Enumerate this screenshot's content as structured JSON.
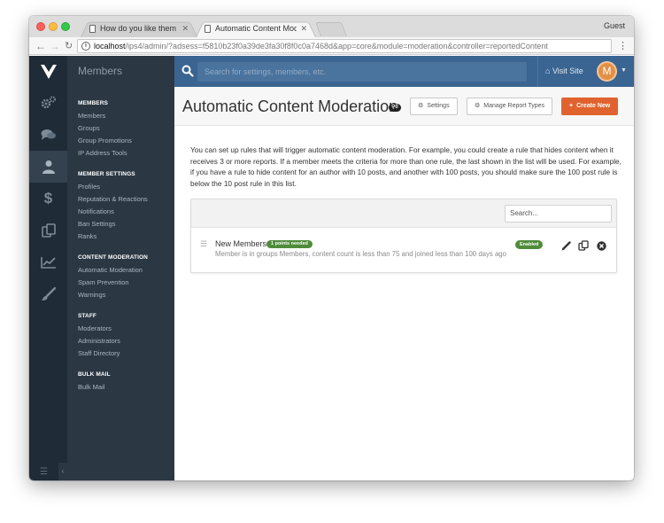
{
  "browser": {
    "tabs": [
      {
        "label": "How do you like them apples?"
      },
      {
        "label": "Automatic Content Moderation"
      }
    ],
    "profile": "Guest",
    "url": {
      "host": "localhost",
      "path": "/ips4/admin/?adsess=f5810b23f0a39de3fa30f8f0c0a7468d&app=core&module=moderation&controller=reportedContent"
    }
  },
  "topbar": {
    "section": "Members",
    "search_placeholder": "Search for settings, members, etc.",
    "visit_site": "Visit Site",
    "avatar_letter": "M"
  },
  "sidebar": {
    "groups": [
      {
        "heading": "MEMBERS",
        "items": [
          "Members",
          "Groups",
          "Group Promotions",
          "IP Address Tools"
        ]
      },
      {
        "heading": "MEMBER SETTINGS",
        "items": [
          "Profiles",
          "Reputation & Reactions",
          "Notifications",
          "Ban Settings",
          "Ranks"
        ]
      },
      {
        "heading": "CONTENT MODERATION",
        "items": [
          "Automatic Moderation",
          "Spam Prevention",
          "Warnings"
        ]
      },
      {
        "heading": "STAFF",
        "items": [
          "Moderators",
          "Administrators",
          "Staff Directory"
        ]
      },
      {
        "heading": "BULK MAIL",
        "items": [
          "Bulk Mail"
        ]
      }
    ]
  },
  "page": {
    "title": "Automatic Content Moderation",
    "title_badge": "0",
    "buttons": {
      "settings": "Settings",
      "manage_report_types": "Manage Report Types",
      "create_new": "Create New"
    },
    "intro": "You can set up rules that will trigger automatic content moderation. For example, you could create a rule that hides content when it receives 3 or more reports. If a member meets the criteria for more than one rule, the last shown in the list will be used. For example, if you have a rule to hide content for an author with 10 posts, and another with 100 posts, you should make sure the 100 post rule is below the 10 post rule in this list.",
    "list_search_placeholder": "Search...",
    "rules": [
      {
        "name": "New Members",
        "points_badge": "1 points needed",
        "description": "Member is in groups Members, content count is less than 75 and joined less than 100 days ago",
        "status": "Enabled"
      }
    ]
  },
  "colors": {
    "topbar": "#3a6491",
    "sidebar": "#2b3844",
    "rail": "#1f2b37",
    "accent_button": "#e0632f",
    "success_badge": "#4f8b3b"
  }
}
